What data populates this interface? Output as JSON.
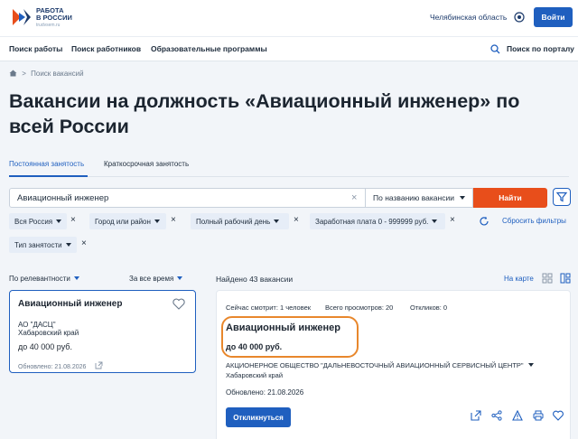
{
  "header": {
    "logo_line1": "РАБОТА",
    "logo_line2": "В РОССИИ",
    "logo_sub": "trudvsem.ru",
    "region": "Челябинская область",
    "login_label": "Войти"
  },
  "nav": {
    "items": [
      "Поиск работы",
      "Поиск работников",
      "Образовательные программы"
    ],
    "portal_search": "Поиск по порталу"
  },
  "breadcrumb": {
    "sep": ">",
    "current": "Поиск вакансий"
  },
  "page_title": "Вакансии на должность «Авиационный инженер» по всей России",
  "tabs": [
    "Постоянная занятость",
    "Краткосрочная занятость"
  ],
  "search": {
    "value": "Авиационный инженер",
    "clear": "×",
    "mode": "По названию вакансии",
    "find_label": "Найти"
  },
  "filters": {
    "chips": [
      "Вся Россия",
      "Город или район",
      "Полный рабочий день",
      "Заработная плата 0 - 999999 руб.",
      "Тип занятости"
    ],
    "remove": "×",
    "reset_label": "Сбросить фильтры"
  },
  "sorting": {
    "relevance": "По релевантности",
    "period": "За все время"
  },
  "results": {
    "found": "Найдено 43 вакансии",
    "on_map": "На карте"
  },
  "selected_card": {
    "title": "Авиационный инженер",
    "company": "АО \"ДАСЦ\"",
    "region": "Хабаровский край",
    "salary": "до 40 000 руб.",
    "updated": "Обновлено: 21.08.2026"
  },
  "detail_card": {
    "viewing": "Сейчас смотрит: 1 человек",
    "views": "Всего просмотров: 20",
    "responses": "Откликов: 0",
    "title": "Авиационный инженер",
    "salary": "до 40 000 руб.",
    "company": "АКЦИОНЕРНОЕ ОБЩЕСТВО \"ДАЛЬНЕВОСТОЧНЫЙ АВИАЦИОННЫЙ СЕРВИСНЫЙ ЦЕНТР\"",
    "region": "Хабаровский край",
    "updated": "Обновлено: 21.08.2026",
    "respond_label": "Откликнуться"
  },
  "colors": {
    "primary": "#1f5fbf",
    "accent": "#e84e1b",
    "highlight": "#e8872c"
  }
}
